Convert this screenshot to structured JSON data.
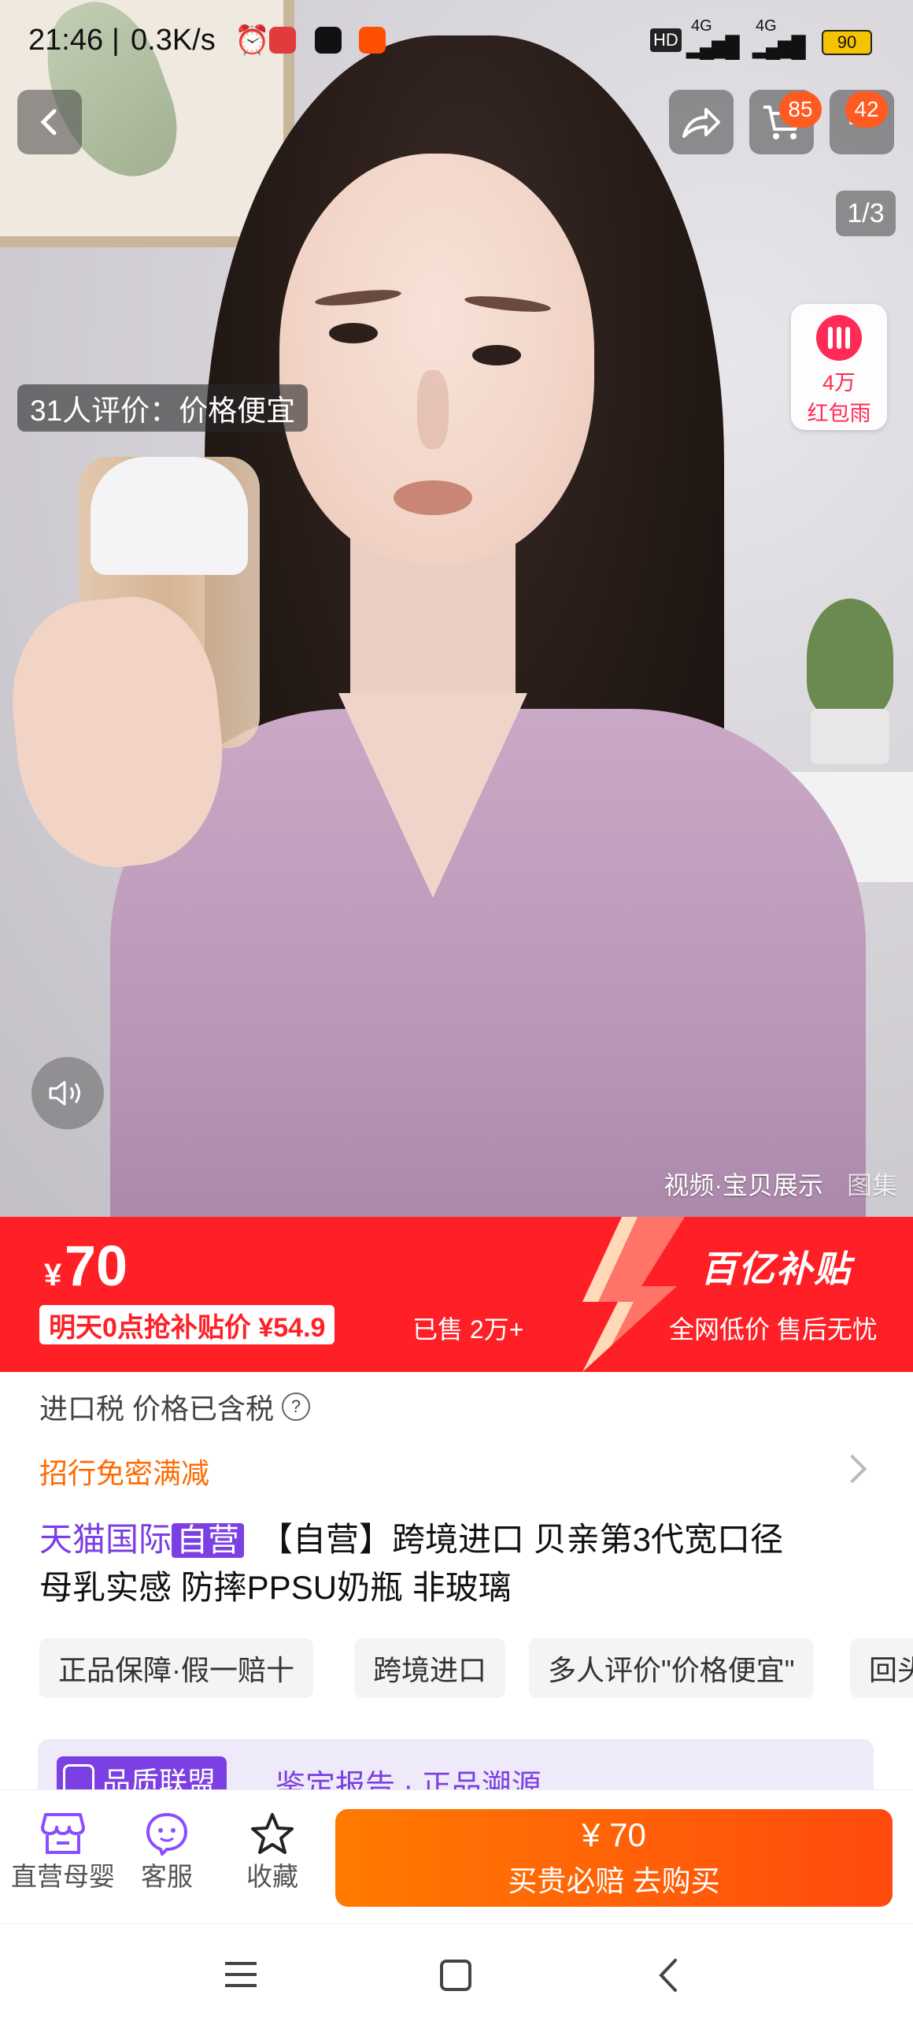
{
  "status_bar": {
    "time": "21:46",
    "net_speed": "0.3K/s",
    "hd": "HD",
    "signal1": "4G",
    "signal2": "4G",
    "battery": "90"
  },
  "header": {
    "cart_count": "85",
    "messages_count": "42",
    "image_index": "1/3"
  },
  "media": {
    "review_tip": "31人评价：价格便宜",
    "red_packet": {
      "amount": "4万",
      "label": "红包雨"
    },
    "tabs": [
      "视频·宝贝展示",
      "图集"
    ]
  },
  "price_band": {
    "currency": "¥",
    "price": "70",
    "promo": "明天0点抢补贴价 ¥54.9",
    "sold": "已售 2万+",
    "subsidy_title": "百亿补贴",
    "guarantee": "全网低价  售后无忧",
    "color_bg": "#ff1f27"
  },
  "info": {
    "tax": "进口税 价格已含税",
    "deal": "招行免密满减",
    "shop_badge": "天猫国际",
    "self_badge": "自营",
    "title_line1": "【自营】跨境进口 贝亲第3代宽口径",
    "title_line2": "母乳实感 防摔PPSU奶瓶 非玻璃",
    "tags": [
      "正品保障·假一赔十",
      "跨境进口",
      "多人评价\"价格便宜\"",
      "回头"
    ],
    "quality": {
      "badge": "品质联盟",
      "text": "鉴定报告 · 正品溯源"
    }
  },
  "bottom_bar": {
    "store": "直营母婴",
    "service": "客服",
    "favorite": "收藏",
    "buy_price": "¥ 70",
    "buy_label": "买贵必赔  去购买"
  },
  "colors": {
    "accent_orange": "#ff5a1f",
    "tmall_purple": "#7b3fe4"
  }
}
